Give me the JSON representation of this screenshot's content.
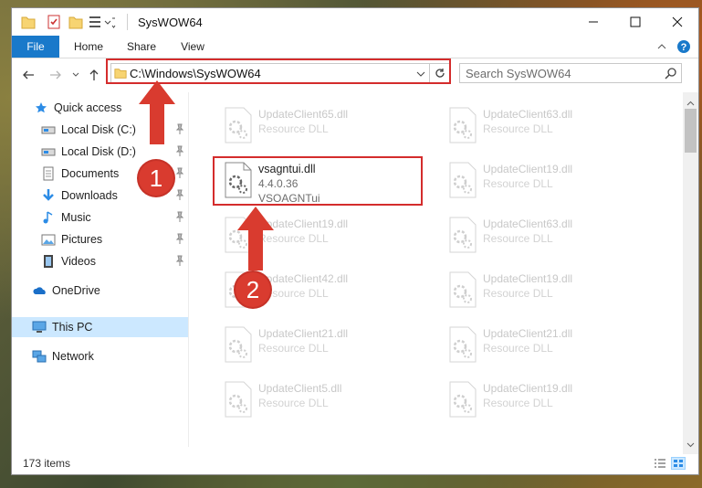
{
  "window": {
    "title": "SysWOW64",
    "controls": [
      "minimize",
      "maximize",
      "close"
    ]
  },
  "ribbon": {
    "tabs": [
      {
        "label": "File",
        "active": true
      },
      {
        "label": "Home"
      },
      {
        "label": "Share"
      },
      {
        "label": "View"
      }
    ]
  },
  "address": {
    "path": "C:\\Windows\\SysWOW64",
    "search_placeholder": "Search SysWOW64"
  },
  "nav": {
    "items": [
      {
        "label": "Quick access",
        "icon": "star-icon"
      },
      {
        "label": "Local Disk (C:)",
        "icon": "drive-icon",
        "pinned": true
      },
      {
        "label": "Local Disk (D:)",
        "icon": "drive-icon",
        "pinned": true
      },
      {
        "label": "Documents",
        "icon": "documents-icon",
        "pinned": true
      },
      {
        "label": "Downloads",
        "icon": "downloads-icon",
        "pinned": true
      },
      {
        "label": "Music",
        "icon": "music-icon",
        "pinned": true
      },
      {
        "label": "Pictures",
        "icon": "pictures-icon",
        "pinned": true
      },
      {
        "label": "Videos",
        "icon": "videos-icon",
        "pinned": true
      },
      {
        "label": "OneDrive",
        "icon": "cloud-icon"
      },
      {
        "label": "This PC",
        "icon": "computer-icon",
        "selected": true
      },
      {
        "label": "Network",
        "icon": "network-icon"
      }
    ]
  },
  "files": {
    "left": [
      {
        "name": "UpdateClient65.dll",
        "type": "Resource DLL"
      },
      {
        "name": "vsagntui.dll",
        "version": "4.4.0.36",
        "description": "VSOAGNTui",
        "highlighted": true
      },
      {
        "name": "UpdateClient19.dll",
        "type": "Resource DLL"
      },
      {
        "name": "UpdateClient42.dll",
        "type": "Resource DLL"
      },
      {
        "name": "UpdateClient21.dll",
        "type": "Resource DLL"
      },
      {
        "name": "UpdateClient5.dll",
        "type": "Resource DLL"
      }
    ],
    "right": [
      {
        "name": "UpdateClient63.dll",
        "type": "Resource DLL"
      },
      {
        "name": "UpdateClient19.dll",
        "type": "Resource DLL"
      },
      {
        "name": "UpdateClient63.dll",
        "type": "Resource DLL"
      },
      {
        "name": "UpdateClient19.dll",
        "type": "Resource DLL"
      },
      {
        "name": "UpdateClient21.dll",
        "type": "Resource DLL"
      },
      {
        "name": "UpdateClient19.dll",
        "type": "Resource DLL"
      }
    ]
  },
  "status": {
    "item_count": "173 items"
  },
  "annotations": {
    "step1": "1",
    "step2": "2"
  },
  "colors": {
    "accent": "#1979ca",
    "highlight": "#d42c2c",
    "selected_nav": "#cce8ff"
  }
}
